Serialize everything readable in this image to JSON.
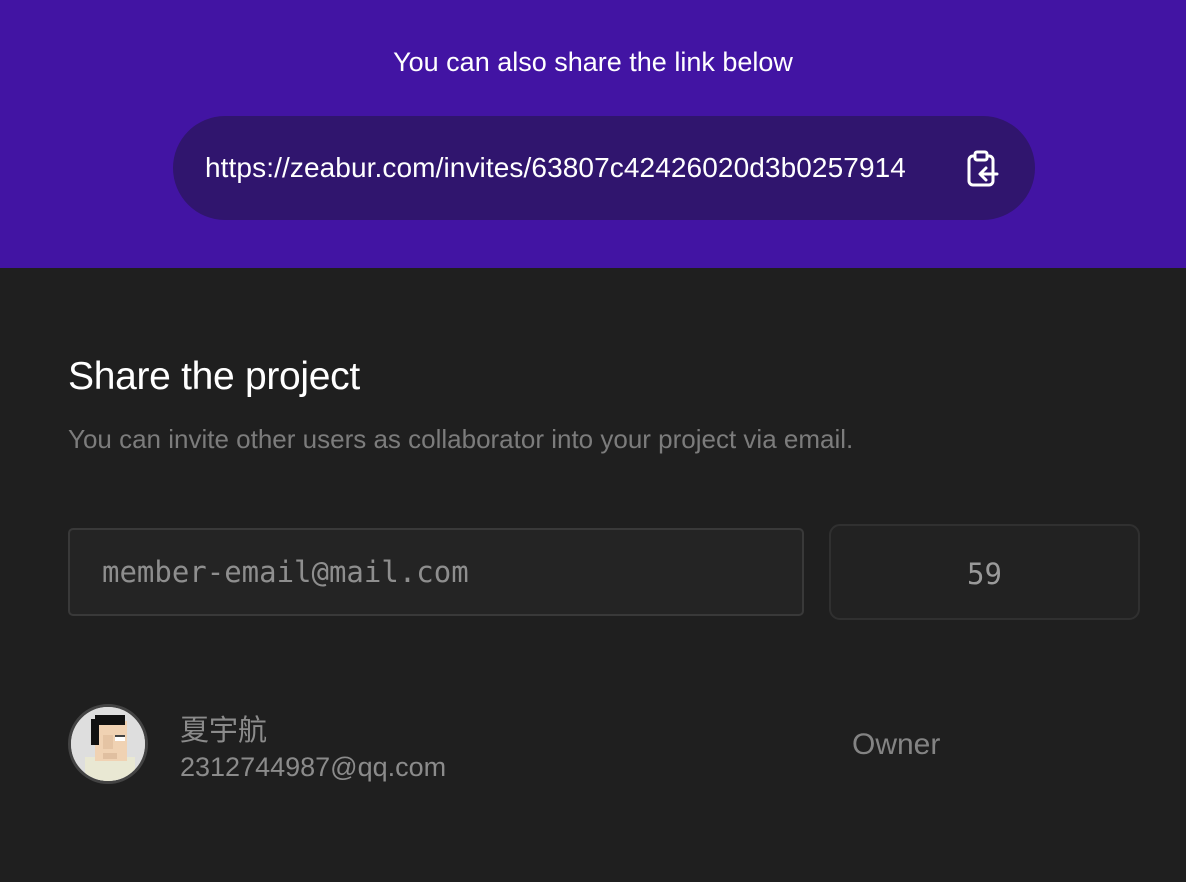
{
  "share_link": {
    "caption": "You can also share the link below",
    "url": "https://zeabur.com/invites/63807c42426020d3b0257914",
    "copy_icon": "clipboard-copy-icon"
  },
  "share_section": {
    "title": "Share the project",
    "description": "You can invite other users as collaborator into your project via email.",
    "email_placeholder": "member-email@mail.com",
    "email_value": "",
    "count": "59"
  },
  "members": [
    {
      "name": "夏宇航",
      "email": "2312744987@qq.com",
      "role": "Owner",
      "avatar_icon": "pixel-avatar-icon"
    }
  ],
  "colors": {
    "banner": "#4214a3",
    "link_pill": "#30156e",
    "background": "#1f1f1f"
  }
}
